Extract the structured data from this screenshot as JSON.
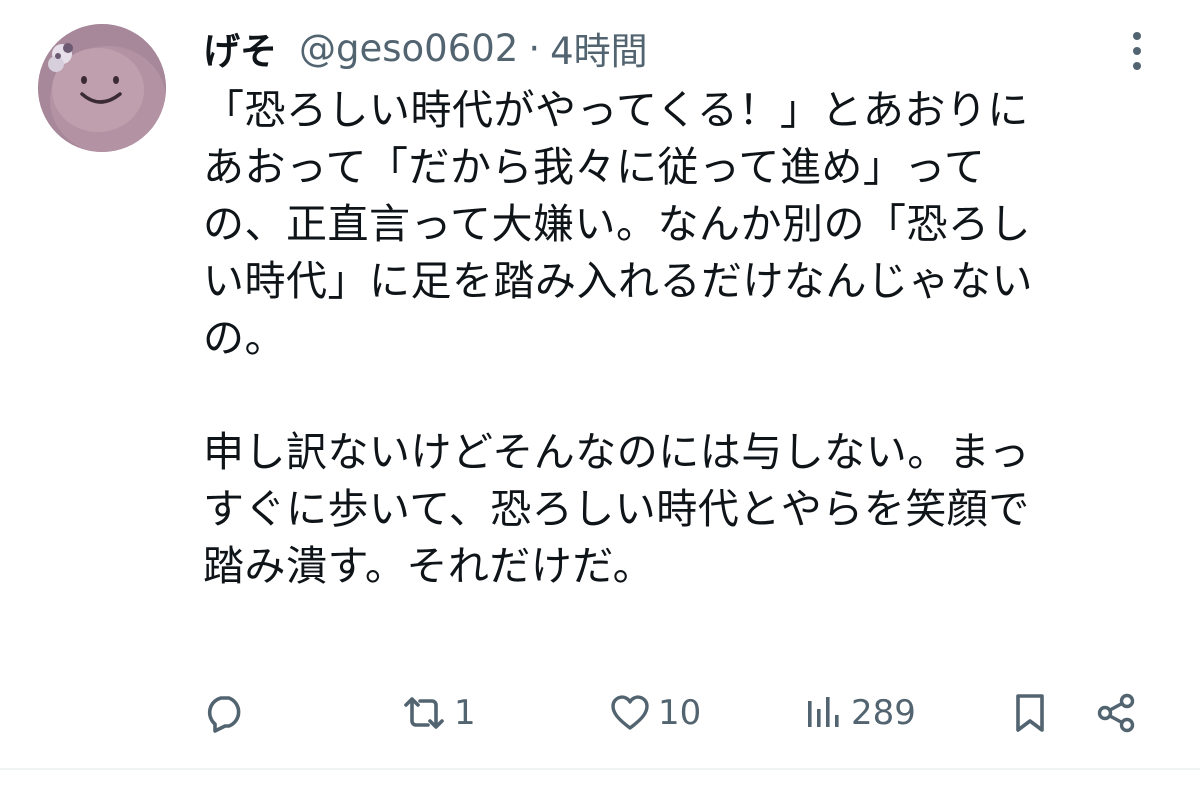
{
  "tweet": {
    "display_name": "げそ",
    "handle": "@geso0602",
    "separator": "·",
    "time": "4時間",
    "body_lines_1": [
      "「恐ろしい時代がやってくる！」とあおりに",
      "あおって「だから我々に従って進め」って",
      "の、正直言って大嫌い。なんか別の「恐ろし",
      "い時代」に足を踏み入れるだけなんじゃない",
      "の。"
    ],
    "body_lines_2": [
      "申し訳ないけどそんなのには与しない。まっ",
      "すぐに歩いて、恐ろしい時代とやらを笑顔で",
      "踏み潰す。それだけだ。"
    ]
  },
  "actions": {
    "reply": {
      "icon": "reply-icon",
      "count": ""
    },
    "retweet": {
      "icon": "retweet-icon",
      "count": "1"
    },
    "like": {
      "icon": "heart-icon",
      "count": "10"
    },
    "views": {
      "icon": "views-icon",
      "count": "289"
    },
    "bookmark": {
      "icon": "bookmark-icon",
      "count": ""
    },
    "share": {
      "icon": "share-icon",
      "count": ""
    }
  },
  "colors": {
    "text": "#0f1419",
    "secondary": "#536471",
    "divider": "#eff3f4",
    "background": "#ffffff"
  }
}
